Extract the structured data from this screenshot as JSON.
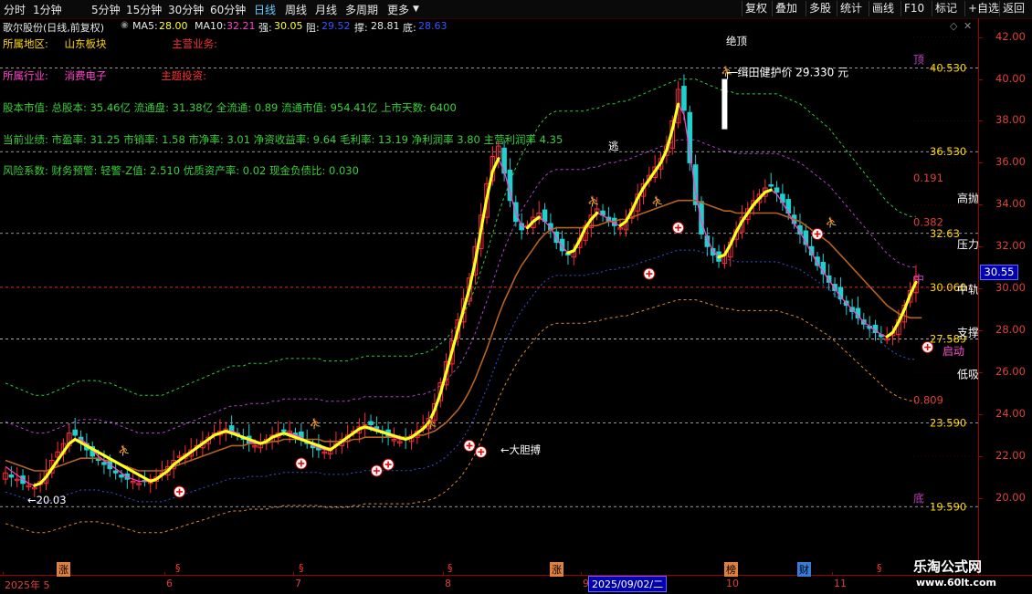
{
  "toolbar": {
    "periods": [
      "分时",
      "1分钟",
      "5分钟",
      "15分钟",
      "30分钟",
      "60分钟",
      "日线",
      "周线",
      "月线",
      "多周期",
      "更多"
    ],
    "active_period": "日线",
    "right_buttons": [
      "复权",
      "叠加",
      "多股",
      "统计",
      "画线",
      "F10",
      "标记",
      "+自选",
      "返回"
    ]
  },
  "stock": {
    "name": "歌尔股份(日线,前复权)",
    "ma5_label": "MA5:",
    "ma5": "28.00",
    "ma10_label": "MA10:",
    "ma10": "32.21",
    "qiang_label": "强:",
    "qiang": "30.05",
    "zu_label": "阻:",
    "zu": "29.52",
    "cheng_label": "撑:",
    "cheng": "28.81",
    "di_label": "底:",
    "di": "28.63"
  },
  "info_lines": {
    "region_label": "所属地区:",
    "region": "山东板块",
    "business_label": "主营业务:",
    "industry_label": "所属行业:",
    "industry": "消费电子",
    "theme_label": "主题投资:",
    "capital": "股本市值: 总股本: 35.46亿 流通盘: 31.38亿 全流通: 0.89 流通市值: 954.41亿 上市天数: 6400",
    "performance": "当前业绩: 市盈率: 31.25 市销率: 1.58 市净率: 3.01 净资收益率: 9.64 毛利率: 13.19 净利润率 3.80 主营利润率 4.35",
    "risk": "风险系数: 财务预警: 轻警-Z值: 2.510 优质资产率: 0.02 现金负债比: 0.030"
  },
  "colors": {
    "up": "#ff2a3a",
    "down": "#1ed0d0",
    "ma_yellow": "#ffff22",
    "ma_magenta": "#ff40c0",
    "ma_brown": "#b8621e",
    "band_green": "#2ecc40",
    "band_orange": "#e08a30",
    "band_blue": "#3a4ed8",
    "band_purple": "#b040d0",
    "axis_red": "#e0403a"
  },
  "chart_data": {
    "type": "candlestick",
    "ylim": [
      18.6,
      42.2
    ],
    "y_ticks": [
      "20.00",
      "22.00",
      "24.00",
      "26.00",
      "28.00",
      "30.00",
      "32.00",
      "34.00",
      "36.00",
      "38.00",
      "40.00",
      "42.00"
    ],
    "current_price": "30.55",
    "x_labels": [
      {
        "text": "2025年 5",
        "x": 5
      },
      {
        "text": "6",
        "x": 182
      },
      {
        "text": "7",
        "x": 323
      },
      {
        "text": "8",
        "x": 487
      },
      {
        "text": "9",
        "x": 638
      },
      {
        "text": "10",
        "x": 795
      },
      {
        "text": "11",
        "x": 913
      }
    ],
    "date_cursor": "2025/09/02/二",
    "closes": [
      21.2,
      21.0,
      20.9,
      20.7,
      20.6,
      20.5,
      20.8,
      21.3,
      21.8,
      22.2,
      22.6,
      23.1,
      23.0,
      22.7,
      22.3,
      22.0,
      21.8,
      21.6,
      21.4,
      21.2,
      21.0,
      20.9,
      20.8,
      20.7,
      20.8,
      20.9,
      21.0,
      21.2,
      21.5,
      21.8,
      22.0,
      22.1,
      22.3,
      22.5,
      22.7,
      22.9,
      23.1,
      23.2,
      23.3,
      23.2,
      23.0,
      22.8,
      22.6,
      22.5,
      22.6,
      22.8,
      23.0,
      23.1,
      23.2,
      23.2,
      23.0,
      22.8,
      22.6,
      22.4,
      22.3,
      22.2,
      22.4,
      22.6,
      22.8,
      23.0,
      23.2,
      23.4,
      23.5,
      23.5,
      23.3,
      23.1,
      22.9,
      22.8,
      22.7,
      22.8,
      23.0,
      23.2,
      23.4,
      23.8,
      24.5,
      25.5,
      26.5,
      27.5,
      28.5,
      29.5,
      30.5,
      32.0,
      33.5,
      35.0,
      36.3,
      36.8,
      35.5,
      34.2,
      33.2,
      32.8,
      33.0,
      33.4,
      33.6,
      33.2,
      32.8,
      32.2,
      31.8,
      31.6,
      31.8,
      32.4,
      33.0,
      33.5,
      33.8,
      33.5,
      33.2,
      33.0,
      32.9,
      33.2,
      33.8,
      34.5,
      35.0,
      35.4,
      35.8,
      36.2,
      36.8,
      38.0,
      39.5,
      38.5,
      36.0,
      34.0,
      32.6,
      32.0,
      31.6,
      31.3,
      31.6,
      32.2,
      32.8,
      33.4,
      33.8,
      34.2,
      34.5,
      34.8,
      34.9,
      34.6,
      34.1,
      33.6,
      33.1,
      32.6,
      32.1,
      31.6,
      31.1,
      30.7,
      30.3,
      29.9,
      29.5,
      29.2,
      28.9,
      28.6,
      28.3,
      28.1,
      27.9,
      27.7,
      27.6,
      27.9,
      28.5,
      29.2,
      29.9,
      30.55
    ],
    "ma_fast": [
      21.5,
      21.3,
      21.1,
      20.9,
      20.7,
      20.6,
      20.7,
      21.0,
      21.4,
      21.8,
      22.2,
      22.6,
      22.8,
      22.8,
      22.6,
      22.3,
      22.0,
      21.8,
      21.6,
      21.4,
      21.2,
      21.0,
      20.9,
      20.8,
      20.8,
      20.8,
      20.9,
      21.1,
      21.3,
      21.6,
      21.8,
      22.0,
      22.2,
      22.4,
      22.6,
      22.8,
      23.0,
      23.1,
      23.2,
      23.2,
      23.1,
      22.9,
      22.7,
      22.6,
      22.6,
      22.7,
      22.9,
      23.0,
      23.1,
      23.1,
      23.0,
      22.9,
      22.7,
      22.5,
      22.4,
      22.3,
      22.3,
      22.5,
      22.7,
      22.9,
      23.1,
      23.3,
      23.4,
      23.4,
      23.3,
      23.2,
      23.0,
      22.9,
      22.8,
      22.8,
      22.9,
      23.1,
      23.3,
      23.6,
      24.2,
      25.0,
      26.0,
      27.0,
      28.0,
      29.0,
      30.0,
      31.3,
      32.8,
      34.3,
      35.6,
      36.2,
      35.6,
      34.6,
      33.6,
      33.0,
      32.9,
      33.2,
      33.4,
      33.2,
      32.9,
      32.4,
      32.0,
      31.7,
      31.8,
      32.3,
      32.9,
      33.3,
      33.6,
      33.5,
      33.3,
      33.1,
      33.0,
      33.2,
      33.7,
      34.3,
      34.8,
      35.2,
      35.6,
      36.0,
      36.6,
      37.6,
      38.8,
      38.3,
      36.5,
      34.6,
      33.2,
      32.4,
      31.8,
      31.5,
      31.6,
      32.1,
      32.7,
      33.2,
      33.6,
      34.0,
      34.3,
      34.6,
      34.7,
      34.5,
      34.1,
      33.6,
      33.1,
      32.7,
      32.2,
      31.7,
      31.2,
      30.8,
      30.4,
      30.0,
      29.6,
      29.3,
      29.0,
      28.7,
      28.4,
      28.2,
      28.0,
      27.8,
      27.7,
      27.9,
      28.4,
      29.0,
      29.7,
      30.3
    ],
    "ma_slow": [
      21.8,
      21.7,
      21.6,
      21.5,
      21.4,
      21.3,
      21.3,
      21.3,
      21.4,
      21.5,
      21.6,
      21.7,
      21.8,
      21.9,
      21.9,
      21.9,
      21.9,
      21.8,
      21.8,
      21.7,
      21.6,
      21.5,
      21.4,
      21.3,
      21.3,
      21.3,
      21.3,
      21.3,
      21.4,
      21.5,
      21.6,
      21.7,
      21.8,
      21.9,
      22.0,
      22.1,
      22.2,
      22.3,
      22.4,
      22.5,
      22.5,
      22.5,
      22.6,
      22.6,
      22.6,
      22.6,
      22.7,
      22.7,
      22.8,
      22.8,
      22.8,
      22.8,
      22.8,
      22.8,
      22.8,
      22.7,
      22.7,
      22.7,
      22.7,
      22.7,
      22.8,
      22.8,
      22.9,
      22.9,
      22.9,
      22.9,
      22.9,
      22.9,
      22.9,
      22.9,
      22.9,
      23.0,
      23.0,
      23.1,
      23.2,
      23.4,
      23.6,
      23.9,
      24.2,
      24.6,
      25.1,
      25.7,
      26.4,
      27.1,
      27.9,
      28.7,
      29.4,
      30.0,
      30.6,
      31.1,
      31.5,
      31.9,
      32.3,
      32.6,
      32.8,
      32.9,
      32.9,
      32.9,
      32.9,
      32.9,
      32.9,
      33.0,
      33.0,
      33.1,
      33.2,
      33.2,
      33.3,
      33.3,
      33.4,
      33.5,
      33.6,
      33.7,
      33.8,
      33.9,
      34.0,
      34.1,
      34.2,
      34.2,
      34.2,
      34.2,
      34.1,
      34.0,
      33.9,
      33.8,
      33.7,
      33.7,
      33.6,
      33.6,
      33.6,
      33.6,
      33.6,
      33.6,
      33.6,
      33.6,
      33.5,
      33.4,
      33.3,
      33.2,
      33.0,
      32.8,
      32.6,
      32.4,
      32.2,
      31.9,
      31.6,
      31.3,
      31.0,
      30.7,
      30.4,
      30.1,
      29.8,
      29.5,
      29.2,
      29.0,
      28.8,
      28.7,
      28.6,
      28.6,
      28.6
    ],
    "band_levels": [
      {
        "value": "40.530",
        "side": "顶",
        "y": 40.53
      },
      {
        "value": "36.530",
        "y": 36.53
      },
      {
        "value": "32.63",
        "y": 32.63
      },
      {
        "value": "30.060",
        "side": "中",
        "y": 30.06
      },
      {
        "value": "27.589",
        "y": 27.589
      },
      {
        "value": "23.590",
        "y": 23.59
      },
      {
        "value": "19.590",
        "side": "底",
        "y": 19.59
      }
    ],
    "fib_labels": [
      {
        "text": "0.191",
        "y": 35.1
      },
      {
        "text": "0.382",
        "y": 33.0
      },
      {
        "text": "0.809",
        "y": 24.5
      }
    ],
    "right_annotations": [
      {
        "text": "高抛",
        "y": 34.3
      },
      {
        "text": "压力",
        "y": 32.1
      },
      {
        "text": "中轨",
        "y": 29.95
      },
      {
        "text": "支撑",
        "y": 27.9
      },
      {
        "text": "低吸",
        "y": 25.9
      },
      {
        "text": "启动",
        "y": 27.0
      }
    ],
    "annotations": [
      {
        "text": "←20.03",
        "x": 30,
        "y": 19.9
      },
      {
        "text": "逃",
        "x": 666,
        "y": 36.8
      },
      {
        "text": "←大胆搏",
        "x": 548,
        "y": 22.3
      },
      {
        "text": "绝顶",
        "x": 795,
        "y": 41.8
      }
    ],
    "protect_price_label": "┌─缉田健护价",
    "protect_price": "29.330",
    "protect_price_unit": "元"
  },
  "bottom_markers": [
    "涨",
    "§",
    "§",
    "§",
    "涨",
    "榜",
    "财",
    "§"
  ],
  "watermark": {
    "title": "乐淘公式网",
    "url": "www.60lt.com"
  }
}
